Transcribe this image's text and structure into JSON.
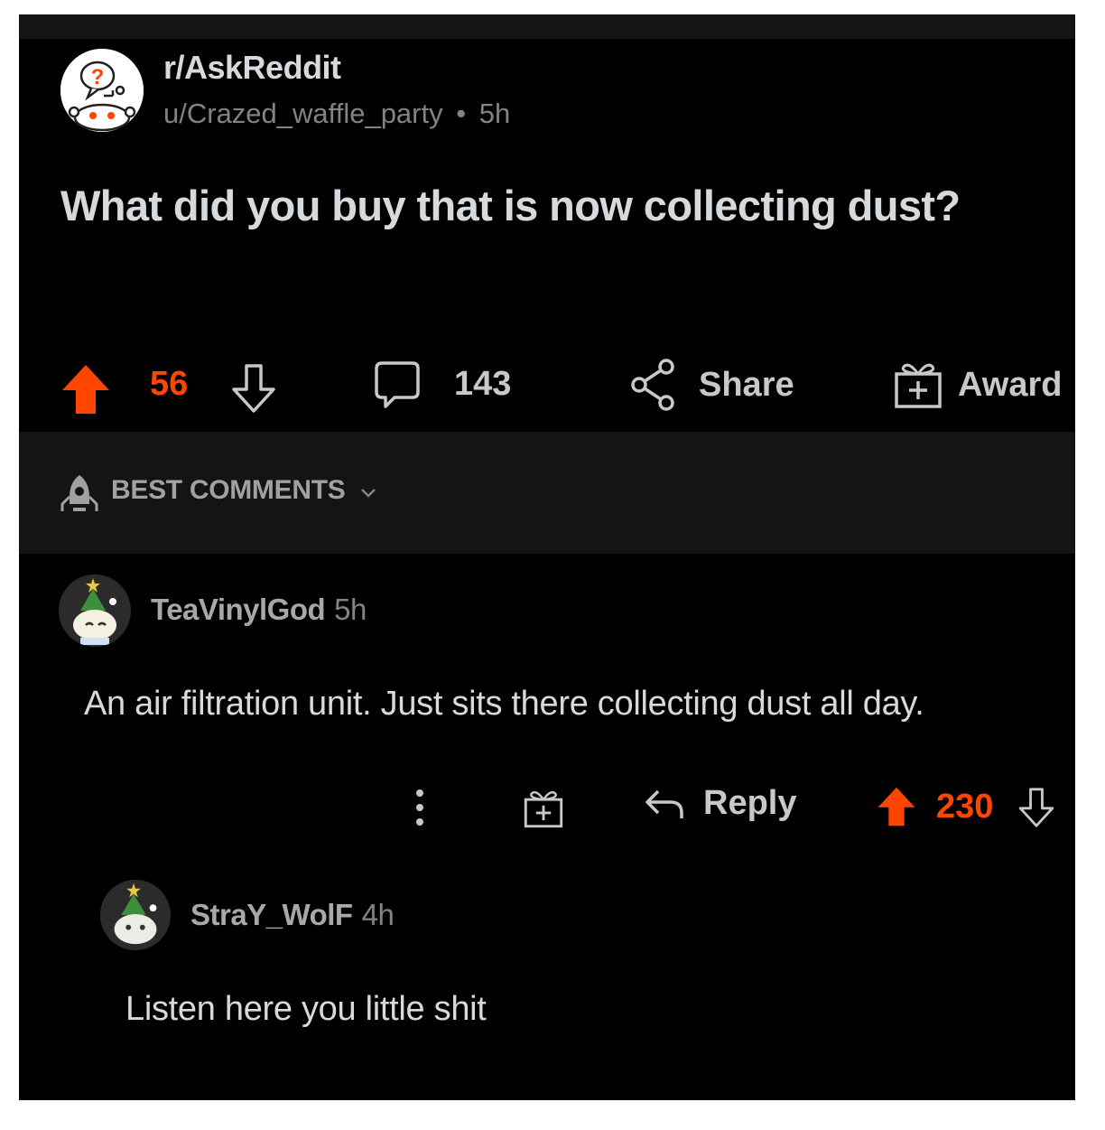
{
  "post": {
    "subreddit": "r/AskReddit",
    "author": "u/Crazed_waffle_party",
    "separator": "•",
    "age": "5h",
    "title": "What did you buy that is now collecting dust?",
    "upvotes": "56",
    "comments": "143",
    "share_label": "Share",
    "award_label": "Award"
  },
  "sort": {
    "label": "BEST COMMENTS"
  },
  "comments": [
    {
      "user": "TeaVinylGod",
      "age": "5h",
      "body": "An air filtration unit. Just sits there collecting dust all day.",
      "reply_label": "Reply",
      "votes": "230"
    },
    {
      "user": "StraY_WolF",
      "age": "4h",
      "body": "Listen here you little shit"
    }
  ],
  "colors": {
    "accent": "#ff4500",
    "background": "#000000",
    "panel": "#141414",
    "text": "#d7dadc",
    "muted": "#818384"
  }
}
